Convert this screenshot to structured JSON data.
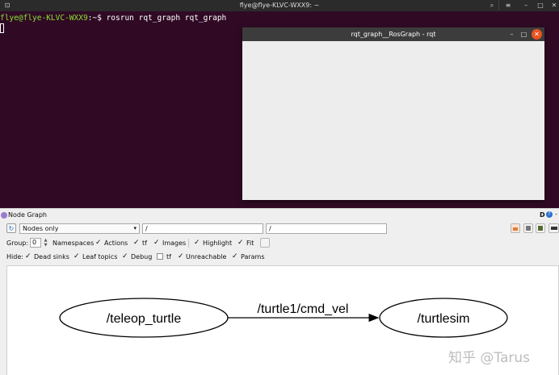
{
  "terminal": {
    "window_title": "flye@flye-KLVC-WXX9: ~",
    "prompt_user": "flye@flye-KLVC-WXX9",
    "prompt_sep": ":~$",
    "command": " rosrun rqt_graph rqt_graph",
    "controls": {
      "search": "⌕",
      "menu": "≡",
      "minimize": "–",
      "maximize": "□",
      "close": "✕"
    }
  },
  "rqt_window": {
    "title": "rqt_graph__RosGraph - rqt",
    "controls": {
      "minimize": "–",
      "maximize": "□",
      "close": "✕"
    }
  },
  "node_graph": {
    "panel_title": "Node Graph",
    "header_right_label": "D",
    "help_glyph": "?",
    "dash": "-",
    "refresh_glyph": "↻",
    "mode_select": "Nodes only",
    "ns_filter": "/",
    "topic_filter": "/",
    "group_label": "Group:",
    "group_value": "0",
    "options_group": [
      {
        "label": "Namespaces",
        "checked": true
      },
      {
        "label": "Actions",
        "checked": true
      },
      {
        "label": "tf",
        "checked": true
      },
      {
        "label": "Images",
        "checked": true
      },
      {
        "label": "Highlight",
        "checked": true
      },
      {
        "label": "Fit",
        "checked": true
      }
    ],
    "hide_label": "Hide:",
    "options_hide": [
      {
        "label": "Dead sinks",
        "checked": true
      },
      {
        "label": "Leaf topics",
        "checked": true
      },
      {
        "label": "Debug",
        "checked": true
      },
      {
        "label": "tf",
        "checked": false
      },
      {
        "label": "Unreachable",
        "checked": true
      },
      {
        "label": "Params",
        "checked": true
      }
    ],
    "graph": {
      "source_node": "/teleop_turtle",
      "edge_label": "/turtle1/cmd_vel",
      "target_node": "/turtlesim"
    }
  },
  "watermark": "知乎 @Tarus",
  "colors": {
    "terminal_bg": "#300a24",
    "prompt_user": "#8ae234",
    "prompt_path": "#729fcf",
    "close_accent": "#e95420"
  }
}
